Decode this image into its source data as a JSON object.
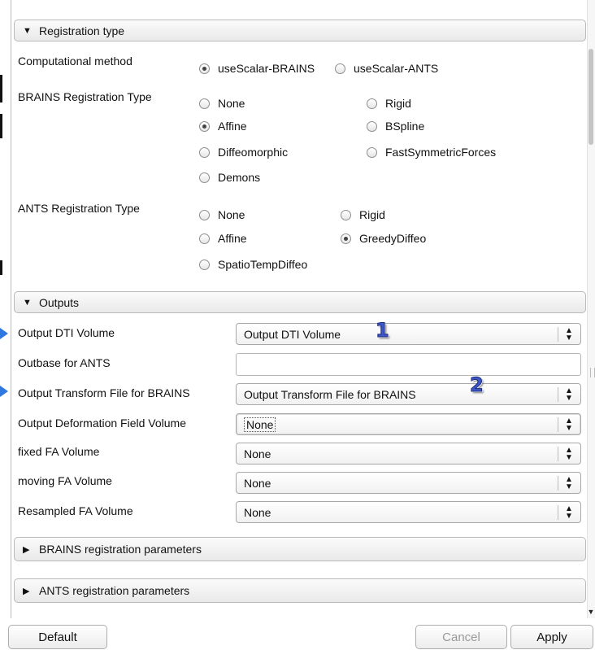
{
  "sections": {
    "registration_type": {
      "title": "Registration type",
      "computational_method": {
        "label": "Computational method",
        "options": [
          {
            "label": "useScalar-BRAINS",
            "checked": true
          },
          {
            "label": "useScalar-ANTS",
            "checked": false
          }
        ]
      },
      "brains_registration_type": {
        "label": "BRAINS Registration Type",
        "options": [
          {
            "label": "None",
            "checked": false
          },
          {
            "label": "Rigid",
            "checked": false
          },
          {
            "label": "Affine",
            "checked": true
          },
          {
            "label": "BSpline",
            "checked": false
          },
          {
            "label": "Diffeomorphic",
            "checked": false
          },
          {
            "label": "FastSymmetricForces",
            "checked": false
          },
          {
            "label": "Demons",
            "checked": false
          }
        ]
      },
      "ants_registration_type": {
        "label": "ANTS Registration Type",
        "options": [
          {
            "label": "None",
            "checked": false
          },
          {
            "label": "Rigid",
            "checked": false
          },
          {
            "label": "Affine",
            "checked": false
          },
          {
            "label": "GreedyDiffeo",
            "checked": true
          },
          {
            "label": "SpatioTempDiffeo",
            "checked": false
          }
        ]
      }
    },
    "outputs": {
      "title": "Outputs",
      "fields": [
        {
          "label": "Output DTI Volume",
          "value": "Output DTI Volume"
        },
        {
          "label": "Outbase for ANTS",
          "value": ""
        },
        {
          "label": "Output Transform File for BRAINS",
          "value": "Output Transform File for BRAINS"
        },
        {
          "label": "Output Deformation Field Volume",
          "value": "None"
        },
        {
          "label": "fixed FA Volume",
          "value": "None"
        },
        {
          "label": "moving FA Volume",
          "value": "None"
        },
        {
          "label": "Resampled FA Volume",
          "value": "None"
        }
      ]
    },
    "brains_params": {
      "title": "BRAINS registration parameters"
    },
    "ants_params": {
      "title": "ANTS registration parameters"
    }
  },
  "annotations": {
    "badge_1": "1",
    "badge_2": "2",
    "color": "#3d56c8"
  },
  "buttons": {
    "default": "Default",
    "cancel": "Cancel",
    "apply": "Apply"
  },
  "icons": {
    "expanded": "triangle-down-icon",
    "collapsed": "triangle-right-icon",
    "combo": "updown-arrows-icon"
  }
}
